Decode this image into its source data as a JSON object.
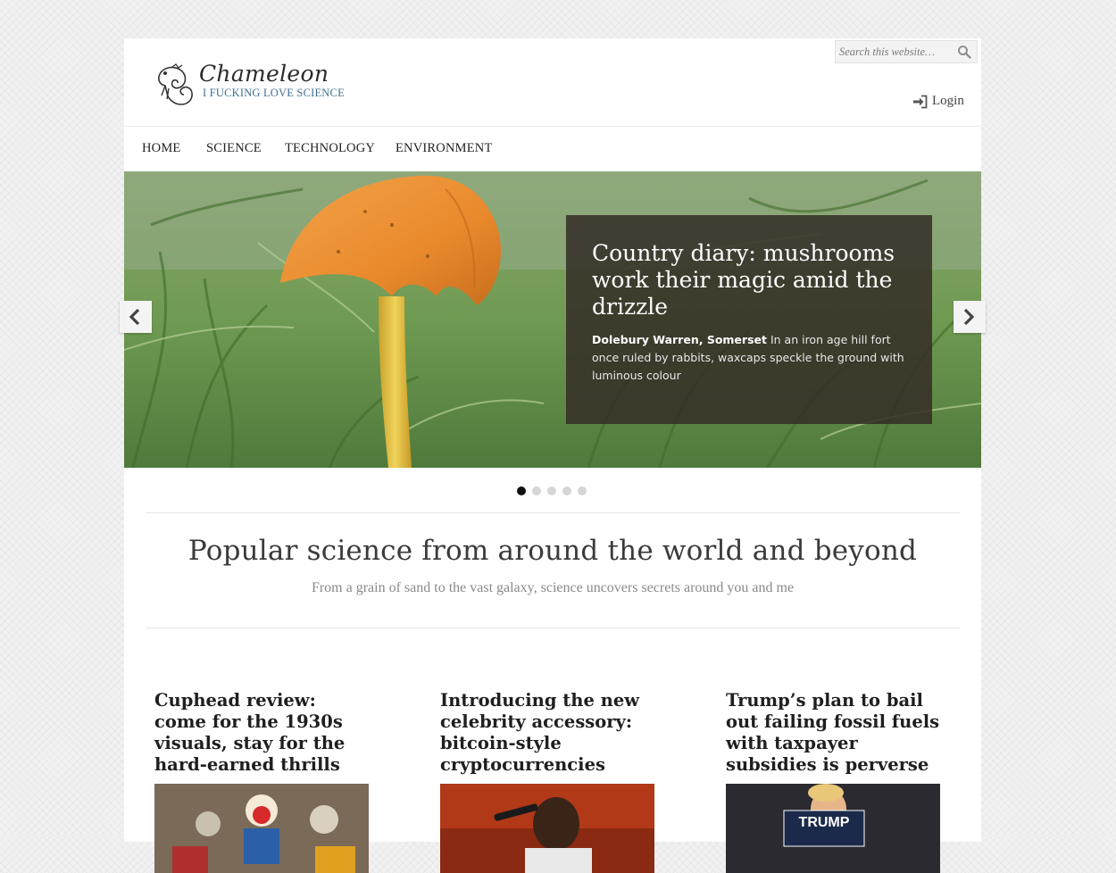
{
  "site": {
    "title": "Chameleon",
    "tagline": "I FUCKING LOVE SCIENCE"
  },
  "search": {
    "placeholder": "Search this website…"
  },
  "login": {
    "label": "Login"
  },
  "nav": [
    "HOME",
    "SCIENCE",
    "TECHNOLOGY",
    "ENVIRONMENT"
  ],
  "slider": {
    "title": "Country diary: mushrooms work their magic amid the drizzle",
    "location": "Dolebury Warren, Somerset",
    "text": " In an iron age hill fort once ruled by rabbits, waxcaps speckle the ground with luminous colour",
    "slide_count": 5,
    "active_slide": 1
  },
  "intro": {
    "heading": "Popular science from around the world and beyond",
    "subheading": "From a grain of sand to the vast galaxy, science uncovers secrets around you and me"
  },
  "posts": [
    {
      "title": "Cuphead review: come for the 1930s visuals, stay for the hard-earned thrills"
    },
    {
      "title": "Introducing the new celebrity accessory: bitcoin-style cryptocurrencies"
    },
    {
      "title": "Trump’s plan to bail out failing fossil fuels with taxpayer subsidies is perverse",
      "image_text": "TRUMP"
    }
  ],
  "colors": {
    "tagline": "#3f6f8f",
    "caption_bg": "#342c26",
    "dot_active": "#111111",
    "dot": "#d6d6d6"
  }
}
